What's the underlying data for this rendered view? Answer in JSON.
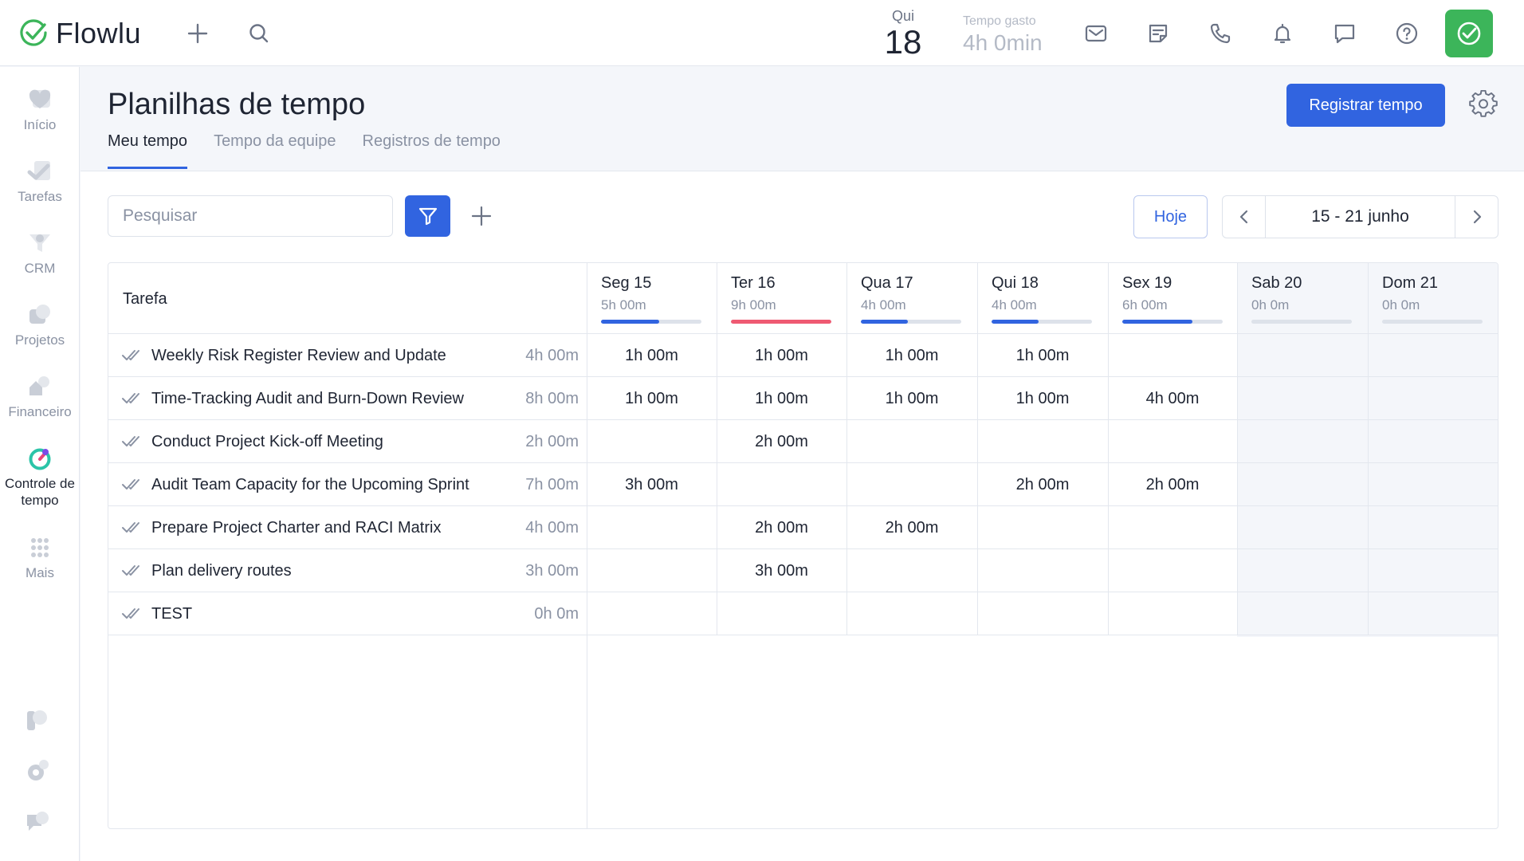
{
  "app": {
    "logo_text": "Flowlu",
    "date": {
      "dow": "Qui",
      "day": "18"
    },
    "time_spent": {
      "label": "Tempo gasto",
      "value": "4h 0min"
    }
  },
  "topbar_icons": [
    "plus-icon",
    "search-icon",
    "mail-icon",
    "notes-icon",
    "phone-icon",
    "bell-icon",
    "chat-icon",
    "help-icon"
  ],
  "sidebar": {
    "items": [
      {
        "label": "Início",
        "icon": "home-icon"
      },
      {
        "label": "Tarefas",
        "icon": "tasks-icon"
      },
      {
        "label": "CRM",
        "icon": "crm-icon"
      },
      {
        "label": "Projetos",
        "icon": "projects-icon"
      },
      {
        "label": "Financeiro",
        "icon": "finance-icon"
      },
      {
        "label": "Controle de tempo",
        "icon": "timer-icon"
      },
      {
        "label": "Mais",
        "icon": "more-icon"
      }
    ]
  },
  "page": {
    "title": "Planilhas de tempo",
    "primary_button": "Registrar tempo",
    "tabs": [
      "Meu tempo",
      "Tempo da equipe",
      "Registros de tempo"
    ],
    "active_tab": 0
  },
  "toolbar": {
    "search_placeholder": "Pesquisar",
    "today_label": "Hoje",
    "date_range": "15 - 21 junho"
  },
  "table": {
    "task_header": "Tarefa",
    "days": [
      {
        "name": "Seg 15",
        "total": "5h 00m",
        "fill": 0.58,
        "color": "#3164e0"
      },
      {
        "name": "Ter 16",
        "total": "9h 00m",
        "fill": 1.0,
        "color": "#ef5a72"
      },
      {
        "name": "Qua 17",
        "total": "4h 00m",
        "fill": 0.47,
        "color": "#3164e0"
      },
      {
        "name": "Qui 18",
        "total": "4h 00m",
        "fill": 0.47,
        "color": "#3164e0"
      },
      {
        "name": "Sex 19",
        "total": "6h 00m",
        "fill": 0.7,
        "color": "#3164e0"
      },
      {
        "name": "Sab 20",
        "total": "0h 0m",
        "fill": 0,
        "color": "#3164e0"
      },
      {
        "name": "Dom 21",
        "total": "0h 0m",
        "fill": 0,
        "color": "#3164e0"
      }
    ],
    "rows": [
      {
        "name": "Weekly Risk Register Review and Update",
        "total": "4h 00m",
        "cells": [
          "1h 00m",
          "1h 00m",
          "1h 00m",
          "1h 00m",
          "",
          "",
          ""
        ]
      },
      {
        "name": "Time-Tracking Audit and Burn-Down Review",
        "total": "8h 00m",
        "cells": [
          "1h 00m",
          "1h 00m",
          "1h 00m",
          "1h 00m",
          "4h 00m",
          "",
          ""
        ]
      },
      {
        "name": "Conduct Project Kick-off Meeting",
        "total": "2h 00m",
        "cells": [
          "",
          "2h 00m",
          "",
          "",
          "",
          "",
          ""
        ]
      },
      {
        "name": "Audit Team Capacity for the Upcoming Sprint",
        "total": "7h 00m",
        "cells": [
          "3h 00m",
          "",
          "",
          "2h 00m",
          "2h 00m",
          "",
          ""
        ]
      },
      {
        "name": "Prepare Project Charter and RACI Matrix",
        "total": "4h 00m",
        "cells": [
          "",
          "2h 00m",
          "2h 00m",
          "",
          "",
          "",
          ""
        ]
      },
      {
        "name": "Plan delivery routes",
        "total": "3h 00m",
        "cells": [
          "",
          "3h 00m",
          "",
          "",
          "",
          "",
          ""
        ]
      },
      {
        "name": "TEST",
        "total": "0h 0m",
        "cells": [
          "",
          "",
          "",
          "",
          "",
          "",
          ""
        ]
      }
    ]
  }
}
